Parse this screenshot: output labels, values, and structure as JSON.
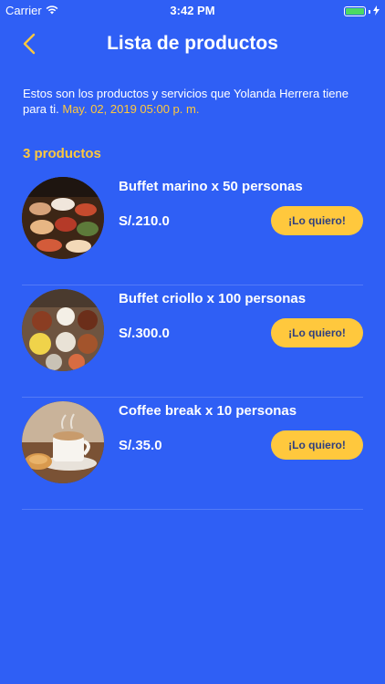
{
  "status_bar": {
    "carrier": "Carrier",
    "time": "3:42 PM"
  },
  "nav": {
    "title": "Lista de productos",
    "back_icon": "chevron-left-icon"
  },
  "intro": {
    "text": "Estos son los productos y servicios que Yolanda Herrera tiene para ti.",
    "date": "May. 02, 2019 05:00 p. m."
  },
  "count_label": "3 productos",
  "products": [
    {
      "name": "Buffet marino x 50 personas",
      "price": "S/.210.0",
      "button": "¡Lo quiero!",
      "image": "seafood-buffet"
    },
    {
      "name": "Buffet criollo x 100 personas",
      "price": "S/.300.0",
      "button": "¡Lo quiero!",
      "image": "creole-buffet"
    },
    {
      "name": "Coffee break x 10 personas",
      "price": "S/.35.0",
      "button": "¡Lo quiero!",
      "image": "coffee-break"
    }
  ],
  "colors": {
    "background": "#2f5ff5",
    "accent": "#ffc83d",
    "button_text": "#2f3f7f"
  }
}
